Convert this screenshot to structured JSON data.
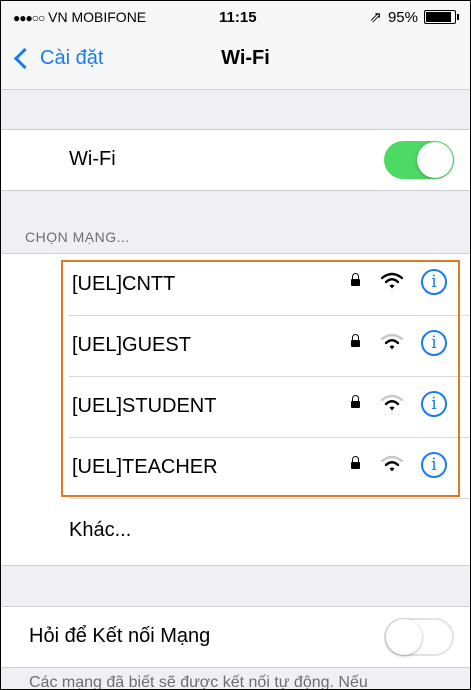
{
  "status_bar": {
    "signal_dots": "●●●○○",
    "carrier": "VN MOBIFONE",
    "time": "11:15",
    "location_glyph": "⇗",
    "battery_percent": "95%",
    "battery_level": 0.95
  },
  "nav": {
    "back_label": "Cài đặt",
    "title": "Wi-Fi"
  },
  "wifi": {
    "label": "Wi-Fi",
    "enabled": true
  },
  "networks_section": {
    "header": "CHỌN MẠNG...",
    "networks": [
      {
        "name": "[UEL]CNTT",
        "secured": true,
        "signal_bars": 3
      },
      {
        "name": "[UEL]GUEST",
        "secured": true,
        "signal_bars": 2
      },
      {
        "name": "[UEL]STUDENT",
        "secured": true,
        "signal_bars": 2
      },
      {
        "name": "[UEL]TEACHER",
        "secured": true,
        "signal_bars": 2
      }
    ],
    "other_label": "Khác..."
  },
  "ask_to_join": {
    "label": "Hỏi để Kết nối Mạng",
    "enabled": false,
    "footnote": "Các mạng đã biết sẽ được kết nối tự động. Nếu"
  },
  "colors": {
    "accent": "#1a7cf5",
    "toggle_on": "#4cd964",
    "highlight": "#e07a20"
  }
}
